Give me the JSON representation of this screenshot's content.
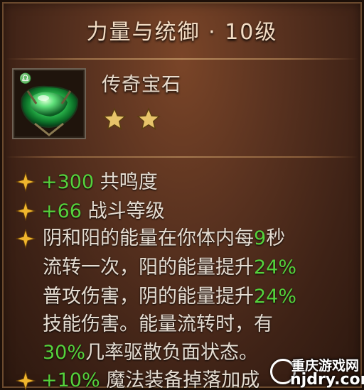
{
  "header": {
    "title": "力量与统御 · 10级"
  },
  "item": {
    "name": "传奇宝石",
    "rank_stars": 2,
    "gem_color": "#2fbf52"
  },
  "stats": [
    {
      "value": "+300",
      "label": "共鸣度"
    },
    {
      "value": "+66",
      "label": "战斗等级"
    }
  ],
  "effect": {
    "line1_a": "阴和阳的能量在你体内每",
    "line1_num": "9",
    "line1_b": "秒",
    "line2_a": "流转一次，阳的能量提升",
    "line2_num": "24%",
    "line3_a": "普攻伤害，阴的能量提升",
    "line3_num": "24%",
    "line4_a": "技能伤害。能量流转时，有",
    "line5_num": "30%",
    "line5_a": "几率驱散负面状态。"
  },
  "bonus": {
    "value": "+10%",
    "label": "魔法装备掉落加成"
  },
  "watermark": {
    "brand": "重庆游戏网",
    "url": "njdry.com"
  },
  "colors": {
    "accent_green": "#55d23c",
    "text": "#e6ddd2",
    "title": "#f2dcc4",
    "star": "#e8c46a"
  }
}
